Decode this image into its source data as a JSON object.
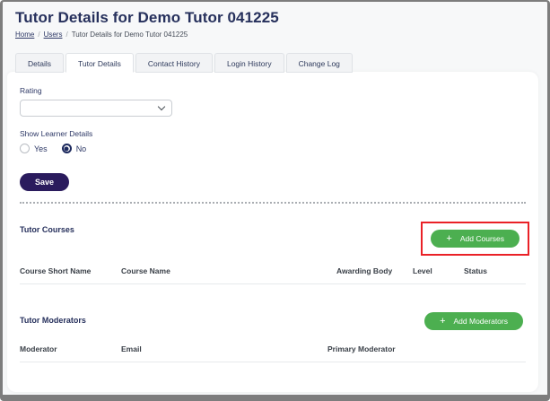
{
  "header": {
    "title": "Tutor Details for Demo Tutor 041225",
    "breadcrumb": {
      "home": "Home",
      "users": "Users",
      "current": "Tutor Details for Demo Tutor 041225",
      "separator": "/"
    }
  },
  "tabs": [
    {
      "label": "Details",
      "active": false
    },
    {
      "label": "Tutor Details",
      "active": true
    },
    {
      "label": "Contact History",
      "active": false
    },
    {
      "label": "Login History",
      "active": false
    },
    {
      "label": "Change Log",
      "active": false
    }
  ],
  "form": {
    "rating_label": "Rating",
    "rating_value": "",
    "show_learner_label": "Show Learner Details",
    "radio_yes": {
      "label": "Yes",
      "selected": false
    },
    "radio_no": {
      "label": "No",
      "selected": true
    },
    "save_label": "Save"
  },
  "courses": {
    "heading": "Tutor Courses",
    "add_button_label": "Add Courses",
    "plus_icon": "+",
    "highlighted": true,
    "columns": [
      "Course Short Name",
      "Course Name",
      "Awarding Body",
      "Level",
      "Status"
    ],
    "rows": []
  },
  "moderators": {
    "heading": "Tutor Moderators",
    "add_button_label": "Add Moderators",
    "plus_icon": "+",
    "columns": [
      "Moderator",
      "Email",
      "Primary Moderator"
    ],
    "rows": []
  },
  "colors": {
    "accent_navy": "#26305c",
    "save_button": "#2a1b5d",
    "add_button_green": "#4caf50",
    "annotation_red": "#ea2127"
  }
}
